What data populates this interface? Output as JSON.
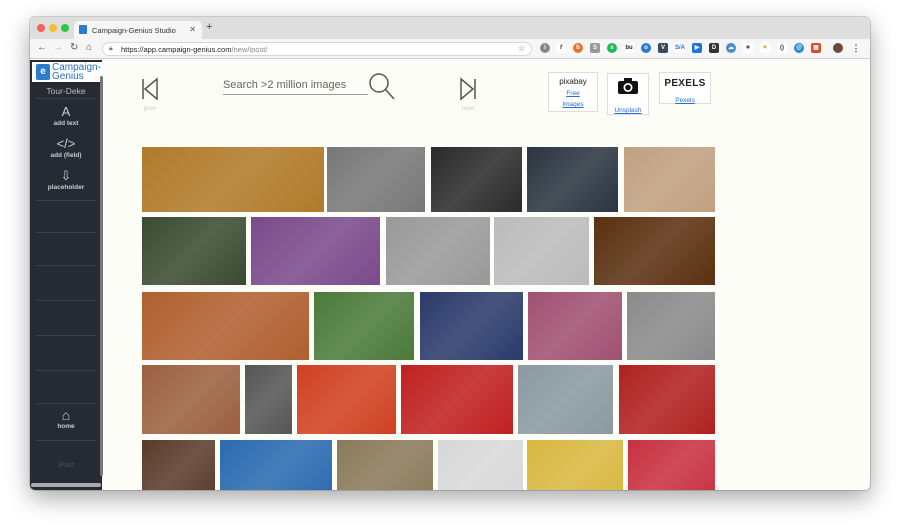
{
  "browser": {
    "tab_title": "Campaign-Genius Studio",
    "new_tab": "+",
    "url_host": "https://app.campaign-genius.com",
    "url_path": "/new/ipost/"
  },
  "sidebar": {
    "brand": "Campaign-Genius",
    "tour_name": "Tour-Deke",
    "items": [
      {
        "label": "add text",
        "icon": "text-icon"
      },
      {
        "label": "add (field)",
        "icon": "code-icon"
      },
      {
        "label": "placeholder",
        "icon": "download-icon"
      }
    ],
    "home_label": "home",
    "footer_logo": "iPost"
  },
  "main": {
    "prev_label": "prev",
    "next_label": "next",
    "search_placeholder": "Search >2 million images",
    "sources": [
      {
        "name": "pixabay",
        "link": "Free Images"
      },
      {
        "name": "camera-icon",
        "link": "Unsplash"
      },
      {
        "name": "PEXELS",
        "link": "Pexels"
      }
    ]
  },
  "images": [
    {
      "label": "two-french-horns",
      "color": "#b07a2a"
    },
    {
      "label": "trumpeter-bw-sketch",
      "color": "#777777"
    },
    {
      "label": "trumpet-valves-bw",
      "color": "#2a2a2a"
    },
    {
      "label": "bmw-logo",
      "color": "#2b3440"
    },
    {
      "label": "trumpets-in-band",
      "color": "#c0a080"
    },
    {
      "label": "man-playing-trumpet",
      "color": "#3a4a30"
    },
    {
      "label": "clown-with-horn",
      "color": "#7a4a8a"
    },
    {
      "label": "canal-houses-bw",
      "color": "#999999"
    },
    {
      "label": "trumpet-sculpture-bw",
      "color": "#bbbbbb"
    },
    {
      "label": "trumpet-closeup-dark",
      "color": "#5a3010"
    },
    {
      "label": "two-trumpets",
      "color": "#b06030"
    },
    {
      "label": "person-in-park",
      "color": "#4a7a3a"
    },
    {
      "label": "marching-band",
      "color": "#2a3a6a"
    },
    {
      "label": "pink-flowers",
      "color": "#a05070"
    },
    {
      "label": "jazz-trumpeter-bw",
      "color": "#8a8a8a"
    },
    {
      "label": "old-town-houses",
      "color": "#9a6040"
    },
    {
      "label": "horn-player-window-bw",
      "color": "#555555"
    },
    {
      "label": "trumpet-flower",
      "color": "#d04020"
    },
    {
      "label": "red-uniform-parade",
      "color": "#c02020"
    },
    {
      "label": "brass-trumpet-closeup",
      "color": "#8a9aa0"
    },
    {
      "label": "red-costume-musician",
      "color": "#b02020"
    },
    {
      "label": "trumpet-bell-dark",
      "color": "#5a3a2a"
    },
    {
      "label": "orange-trumpet-flowers",
      "color": "#2a6ab0"
    },
    {
      "label": "elephant",
      "color": "#8a7a5a"
    },
    {
      "label": "white-horn-abstract",
      "color": "#d8d8d8"
    },
    {
      "label": "brass-instrument-yellow",
      "color": "#d8b840"
    },
    {
      "label": "trumpeter-red-background",
      "color": "#c83040"
    }
  ]
}
